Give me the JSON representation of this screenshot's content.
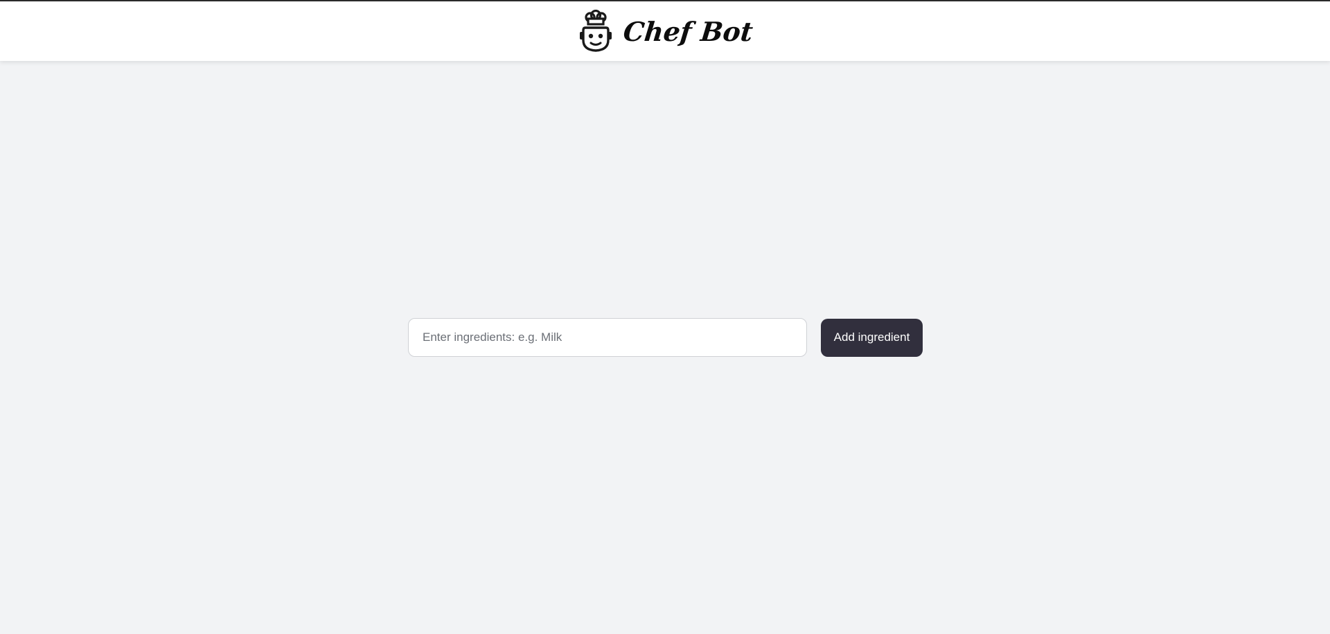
{
  "header": {
    "title": "Chef Bot",
    "logo_icon": "chef-robot-icon"
  },
  "form": {
    "input_value": "",
    "input_placeholder": "Enter ingredients: e.g. Milk",
    "add_button_label": "Add ingredient"
  },
  "colors": {
    "background": "#f2f3f5",
    "header_background": "#ffffff",
    "button_background": "#312f3d",
    "button_text": "#ffffff"
  }
}
